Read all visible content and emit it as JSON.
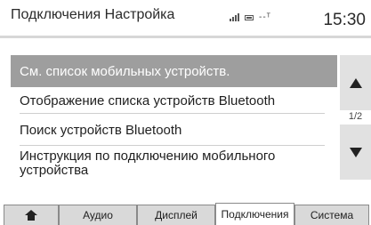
{
  "header": {
    "title": "Подключения Настройка",
    "status_text": "--ᵀ",
    "clock": "15:30"
  },
  "menu": {
    "items": [
      {
        "label": "См. список мобильных устройств.",
        "selected": true
      },
      {
        "label": "Отображение списка устройств Bluetooth",
        "selected": false
      },
      {
        "label": "Поиск устройств Bluetooth",
        "selected": false
      },
      {
        "label": "Инструкция по подключению мобильного устройства",
        "selected": false
      }
    ]
  },
  "scroll": {
    "page_indicator": "1/2"
  },
  "tabs": [
    {
      "label": "",
      "icon": "home-icon",
      "active": false
    },
    {
      "label": "Аудио",
      "active": false
    },
    {
      "label": "Дисплей",
      "active": false
    },
    {
      "label": "Подключения",
      "active": true
    },
    {
      "label": "Система",
      "active": false
    }
  ],
  "colors": {
    "selected_bg": "#9e9e9e",
    "button_bg": "#e1e1e1",
    "tab_bg": "#d9d9d9",
    "tab_active_bg": "#ffffff"
  }
}
